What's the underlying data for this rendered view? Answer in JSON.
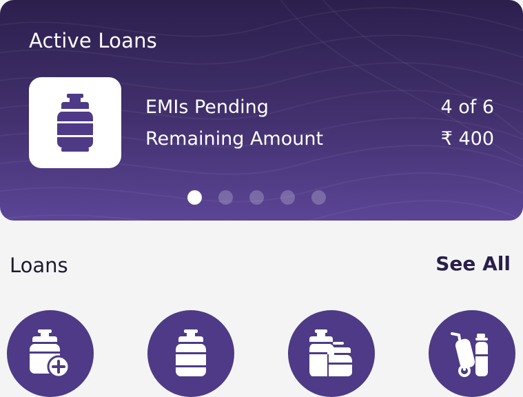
{
  "active_loans": {
    "title": "Active Loans",
    "product_icon": "gas-cylinder-icon",
    "emis_label": "EMIs Pending",
    "emis_value": "4 of 6",
    "remaining_label": "Remaining Amount",
    "remaining_value": "₹ 400",
    "carousel": {
      "total": 5,
      "active_index": 0
    }
  },
  "loans_section": {
    "title": "Loans",
    "see_all_label": "See All",
    "items": [
      {
        "icon": "gas-cylinder-add-icon"
      },
      {
        "icon": "gas-cylinder-icon"
      },
      {
        "icon": "double-gas-cylinder-icon"
      },
      {
        "icon": "cylinder-trolley-icon"
      }
    ]
  },
  "colors": {
    "card_top": "#2c1f4d",
    "card_bottom": "#5b4596",
    "icon_purple": "#4e3a86",
    "page_bg": "#f4f4f5"
  }
}
